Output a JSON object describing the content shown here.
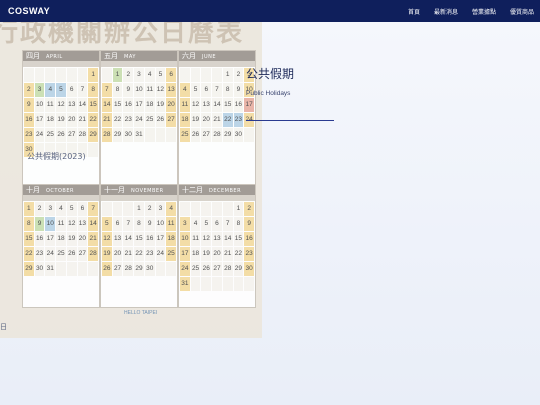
{
  "nav": {
    "logo": "COSWAY",
    "items": [
      "首頁",
      "最新消息",
      "營業據點",
      "優質商品"
    ]
  },
  "poster": {
    "title": "行政機關辦公日曆表",
    "months": [
      {
        "zh": "四月",
        "en": "APRIL"
      },
      {
        "zh": "五月",
        "en": "MAY"
      },
      {
        "zh": "六月",
        "en": "JUNE"
      },
      {
        "zh": "十月",
        "en": "OCTOBER"
      },
      {
        "zh": "十一月",
        "en": "NOVEMBER"
      },
      {
        "zh": "十二月",
        "en": "DECEMBER"
      }
    ],
    "footer": "HELLO TAIPEI"
  },
  "content": {
    "title": "公共假期",
    "subtitle": "Public Holidays",
    "calendar_label": "公共假期(2023)",
    "left_date": "日"
  },
  "colors": {
    "nav_bg": "#0f1f5c",
    "accent_line": "#2a3a90"
  }
}
